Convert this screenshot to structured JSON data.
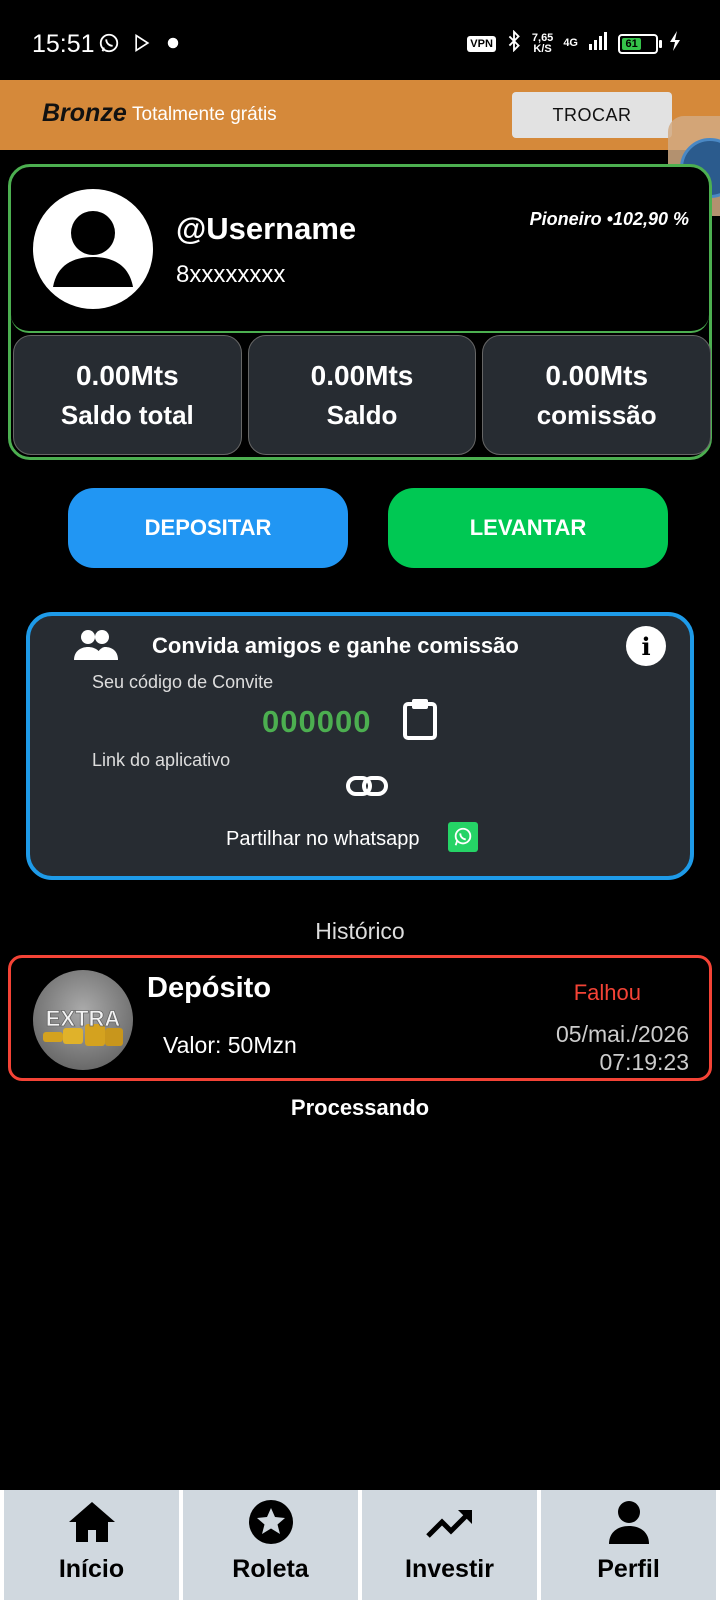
{
  "status_bar": {
    "time": "15:51",
    "vpn": "VPN",
    "speed_value": "7,65",
    "speed_unit": "K/S",
    "network": "4G",
    "battery": "61"
  },
  "plan": {
    "name": "Bronze",
    "description": "Totalmente grátis",
    "switch_label": "TROCAR"
  },
  "profile": {
    "username": "@Username",
    "phone": "8xxxxxxxx",
    "badge": "Pioneiro •102,90 %",
    "stats": [
      {
        "value": "0.00Mts",
        "label": "Saldo total"
      },
      {
        "value": "0.00Mts",
        "label": "Saldo"
      },
      {
        "value": "0.00Mts",
        "label": "comissão"
      }
    ]
  },
  "actions": {
    "deposit": "DEPOSITAR",
    "withdraw": "LEVANTAR"
  },
  "invite": {
    "title": "Convida amigos e ganhe comissão",
    "code_label": "Seu código de Convite",
    "code": "000000",
    "link_label": "Link do aplicativo",
    "share_label": "Partilhar no whatsapp"
  },
  "history": {
    "title": "Histórico",
    "items": [
      {
        "type": "Depósito",
        "value": "Valor: 50Mzn",
        "status": "Falhou",
        "date": "05/mai./2026",
        "time": "07:19:23",
        "thumb_text": "EXTRA"
      }
    ],
    "footer": "Processando"
  },
  "nav": [
    {
      "label": "Início",
      "icon": "home-icon"
    },
    {
      "label": "Roleta",
      "icon": "star-icon"
    },
    {
      "label": "Investir",
      "icon": "trending-up-icon"
    },
    {
      "label": "Perfil",
      "icon": "person-icon"
    }
  ],
  "colors": {
    "plan_bar": "#d5893a",
    "profile_border": "#4caf50",
    "deposit": "#2196f3",
    "withdraw": "#00c853",
    "invite_border": "#1e9be9",
    "failed": "#f44336"
  }
}
